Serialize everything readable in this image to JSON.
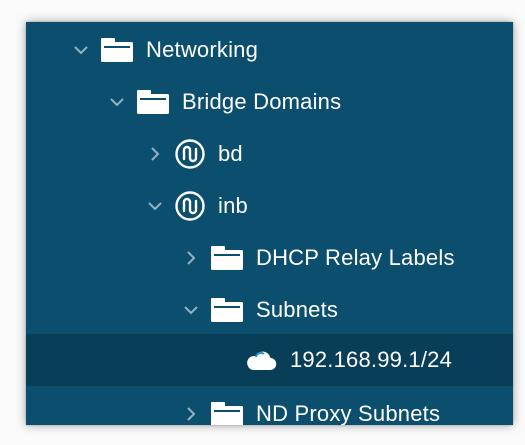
{
  "colors": {
    "panel_bg": "#0c4e6e",
    "selected_row_bg": "#093e58",
    "text": "#ffffff",
    "chevron": "#8fb3c5",
    "folder": "#ffffff"
  },
  "tree": {
    "rows": [
      {
        "label": "Networking",
        "icon": "folder-icon",
        "chevron": "chevron-down-icon"
      },
      {
        "label": "Bridge Domains",
        "icon": "folder-icon",
        "chevron": "chevron-down-icon"
      },
      {
        "label": "bd",
        "icon": "bridge-domain-icon",
        "chevron": "chevron-right-icon"
      },
      {
        "label": "inb",
        "icon": "bridge-domain-icon",
        "chevron": "chevron-down-icon"
      },
      {
        "label": "DHCP Relay Labels",
        "icon": "folder-icon",
        "chevron": "chevron-right-icon"
      },
      {
        "label": "Subnets",
        "icon": "folder-icon",
        "chevron": "chevron-down-icon"
      },
      {
        "label": "192.168.99.1/24",
        "icon": "cloud-icon",
        "selected": true
      },
      {
        "label": "ND Proxy Subnets",
        "icon": "folder-icon",
        "chevron": "chevron-right-icon"
      }
    ]
  }
}
